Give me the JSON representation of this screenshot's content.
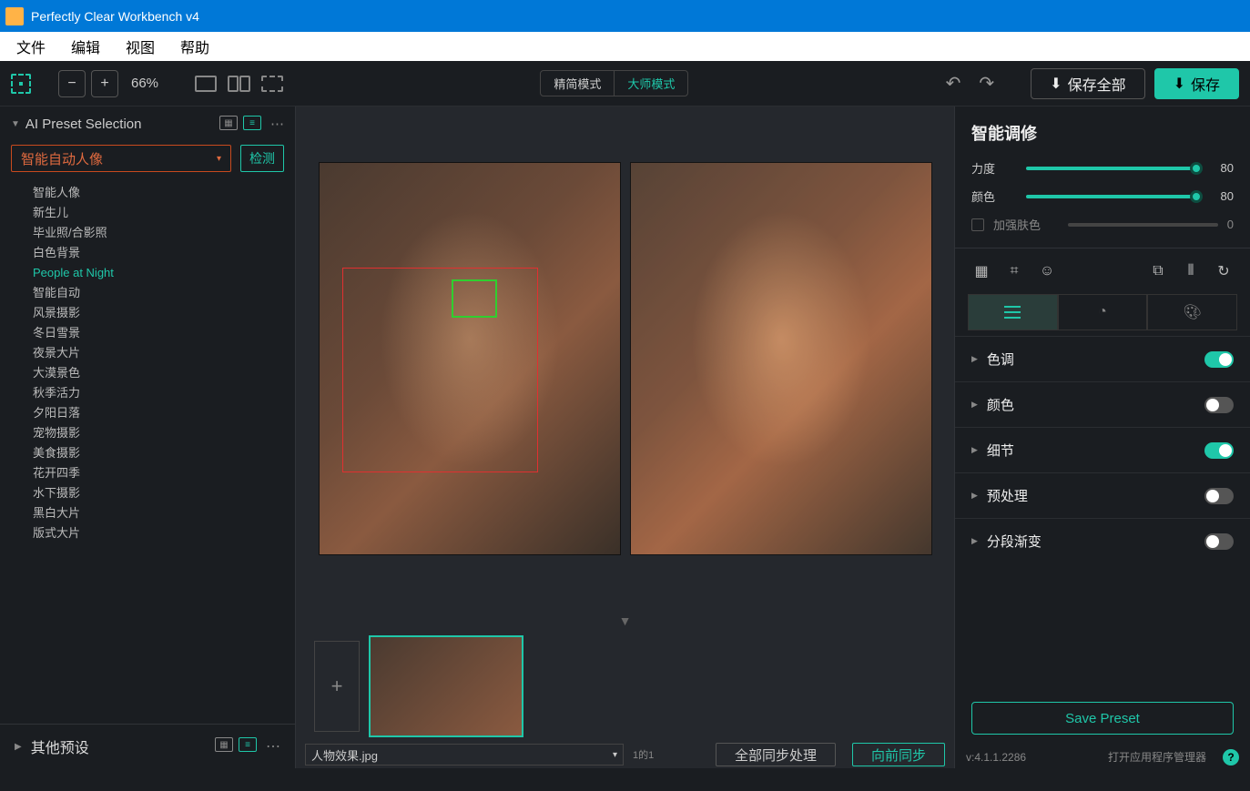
{
  "title": "Perfectly Clear Workbench v4",
  "menu": {
    "file": "文件",
    "edit": "编辑",
    "view": "视图",
    "help": "帮助"
  },
  "toolbar": {
    "zoom": "66%",
    "mode_simple": "精简模式",
    "mode_master": "大师模式",
    "save_all": "保存全部",
    "save": "保存"
  },
  "left_panel": {
    "title": "AI Preset Selection",
    "dropdown": "智能自动人像",
    "detect": "检测",
    "presets": [
      "智能人像",
      "新生儿",
      "毕业照/合影照",
      "白色背景",
      "People at Night",
      "智能自动",
      "风景摄影",
      "冬日雪景",
      "夜景大片",
      "大漠景色",
      "秋季活力",
      "夕阳日落",
      "宠物摄影",
      "美食摄影",
      "花开四季",
      "水下摄影",
      "黑白大片",
      "版式大片"
    ],
    "active_preset_index": 4,
    "other": "其他预设"
  },
  "center": {
    "filename": "人物效果.jpg",
    "counter": "1的1",
    "sync_all": "全部同步处理",
    "sync_fwd": "向前同步"
  },
  "right_panel": {
    "title": "智能调修",
    "sliders": [
      {
        "label": "力度",
        "value": "80"
      },
      {
        "label": "颜色",
        "value": "80"
      }
    ],
    "enhance_skin": "加强肤色",
    "enhance_skin_val": "0",
    "sections": [
      {
        "label": "色调",
        "on": true
      },
      {
        "label": "颜色",
        "on": false
      },
      {
        "label": "细节",
        "on": true
      },
      {
        "label": "预处理",
        "on": false
      },
      {
        "label": "分段渐变",
        "on": false
      }
    ],
    "save_preset": "Save Preset"
  },
  "status": {
    "version": "v:4.1.1.2286",
    "manager": "打开应用程序管理器"
  }
}
